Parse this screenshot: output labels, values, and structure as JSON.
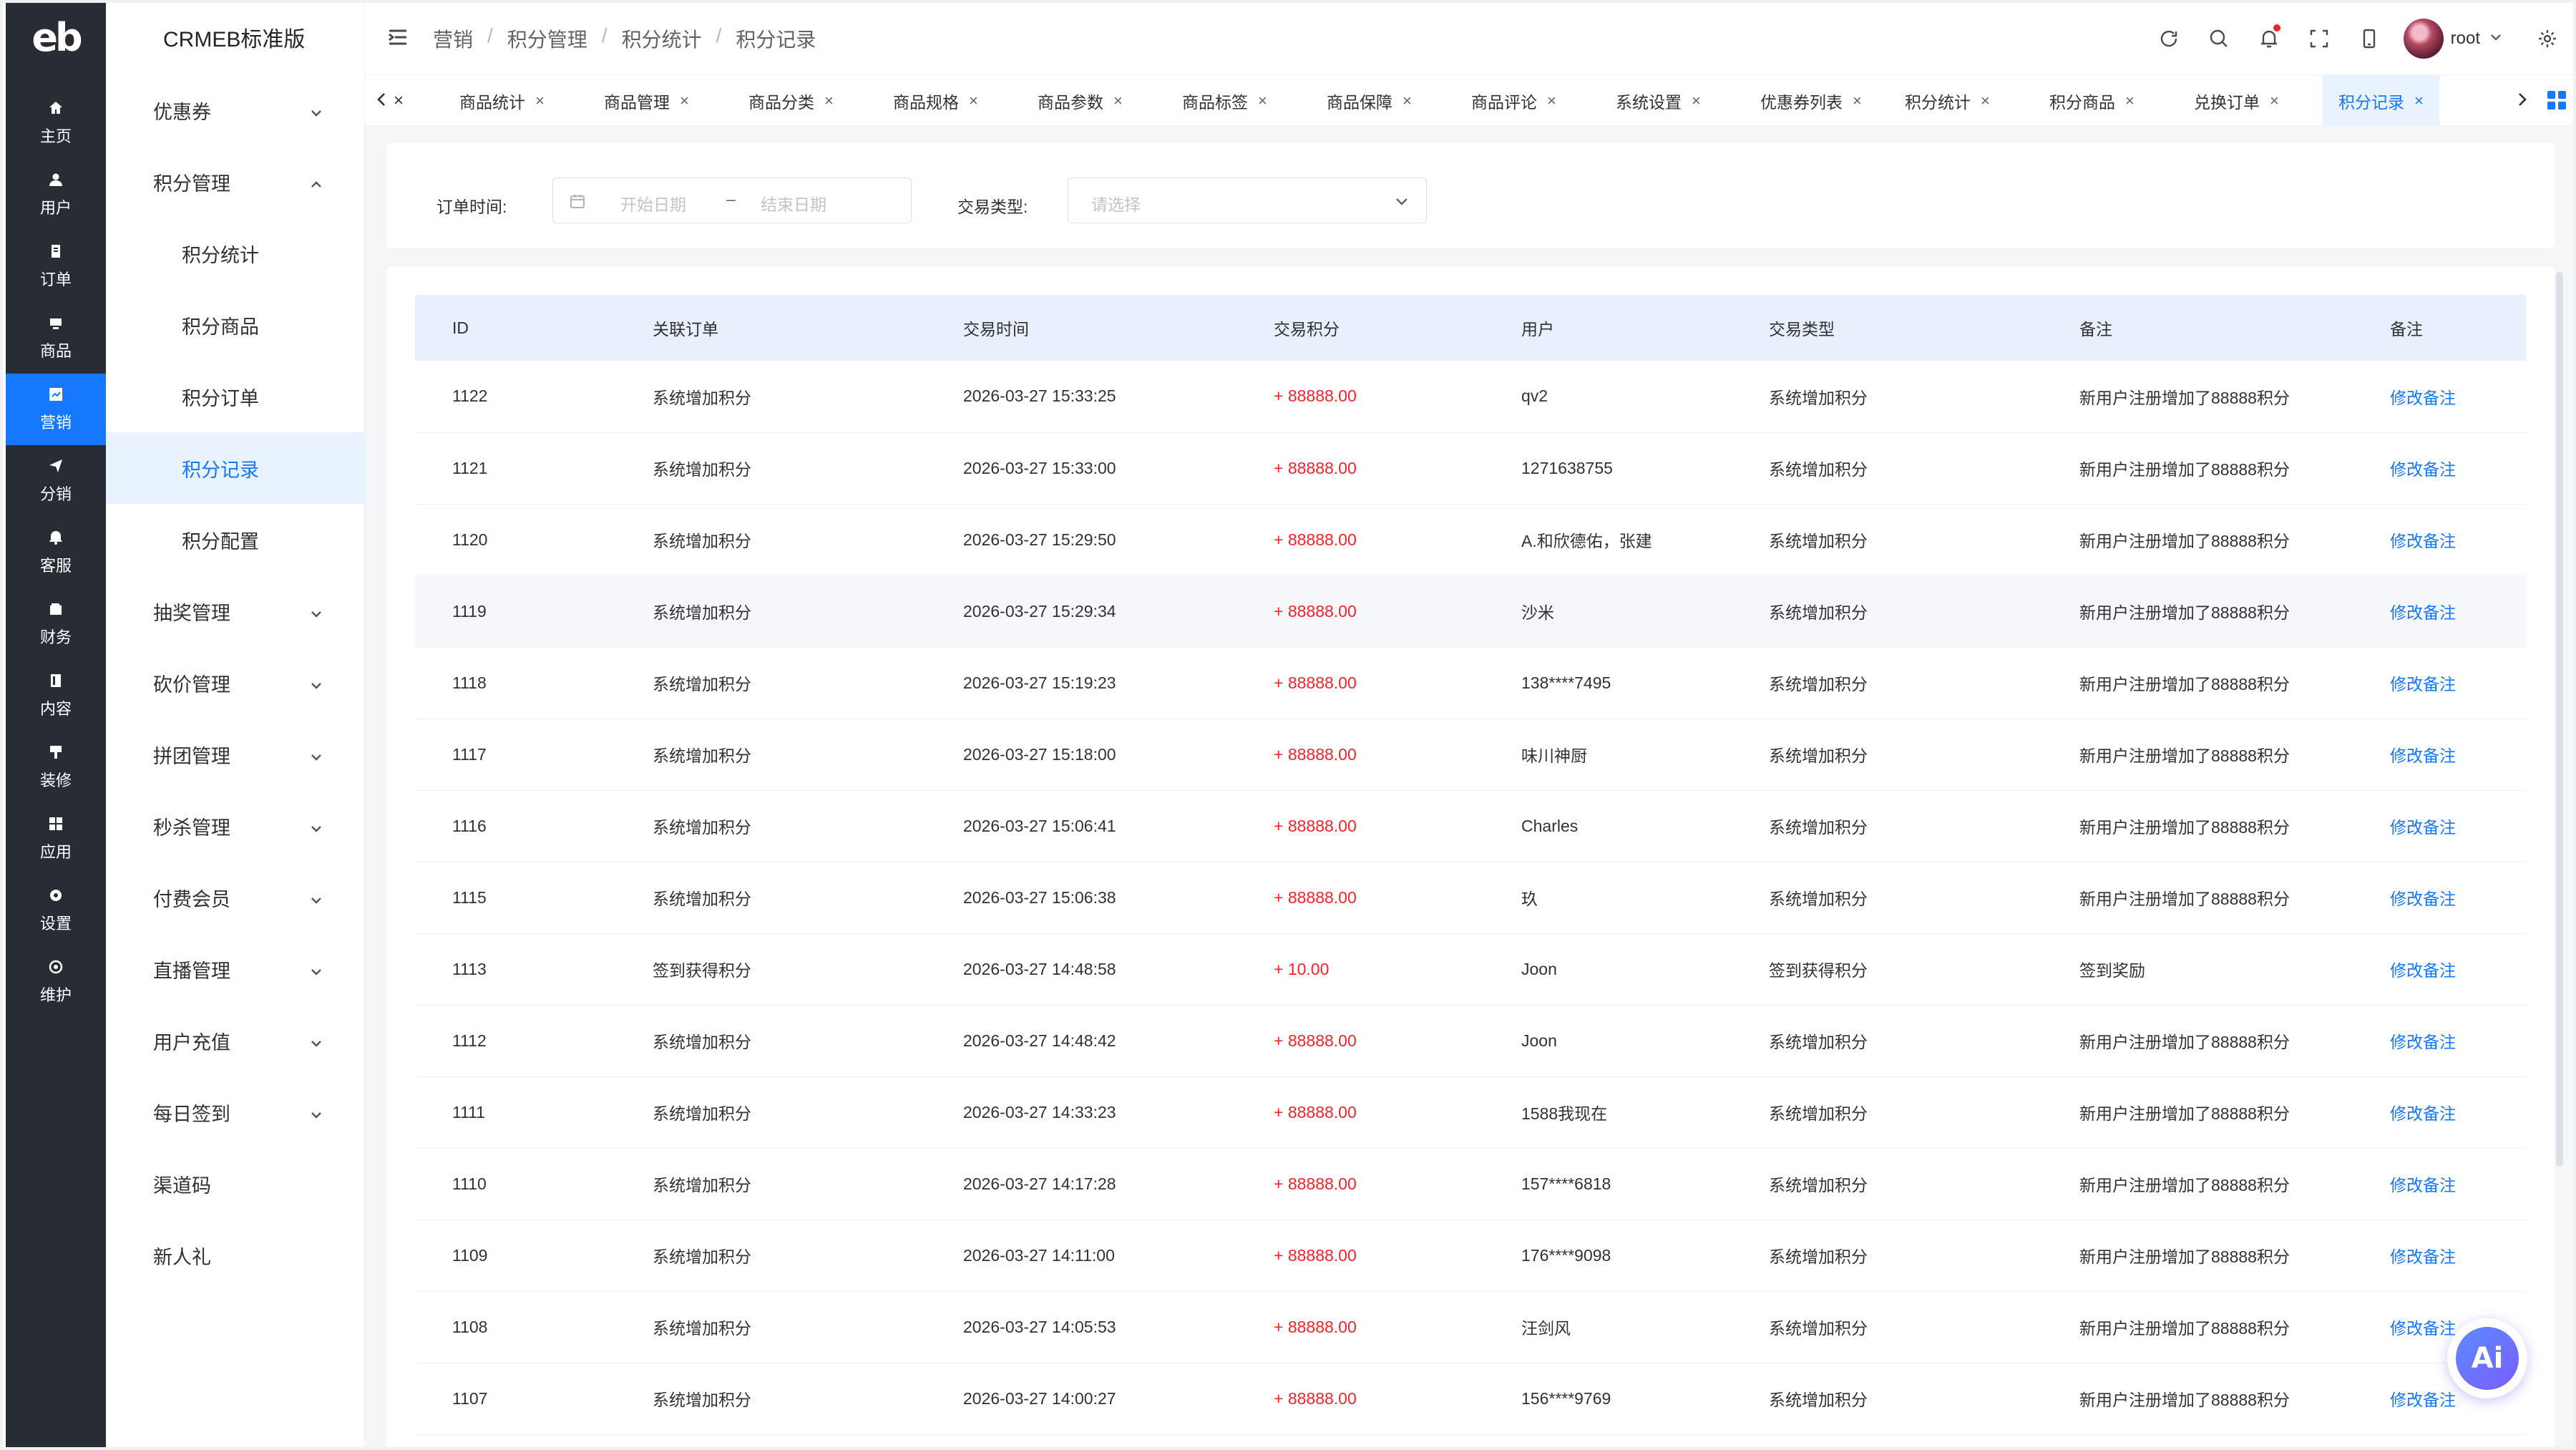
{
  "app": {
    "brand": "CRMEB标准版",
    "logo_text": "eb"
  },
  "rail": [
    {
      "label": "主页",
      "icon": "home-icon",
      "active": false
    },
    {
      "label": "用户",
      "icon": "user-icon",
      "active": false
    },
    {
      "label": "订单",
      "icon": "order-icon",
      "active": false
    },
    {
      "label": "商品",
      "icon": "product-icon",
      "active": false
    },
    {
      "label": "营销",
      "icon": "marketing-icon",
      "active": true
    },
    {
      "label": "分销",
      "icon": "distribution-icon",
      "active": false
    },
    {
      "label": "客服",
      "icon": "service-icon",
      "active": false
    },
    {
      "label": "财务",
      "icon": "finance-icon",
      "active": false
    },
    {
      "label": "内容",
      "icon": "content-icon",
      "active": false
    },
    {
      "label": "装修",
      "icon": "decoration-icon",
      "active": false
    },
    {
      "label": "应用",
      "icon": "apps-icon",
      "active": false
    },
    {
      "label": "设置",
      "icon": "settings-icon",
      "active": false
    },
    {
      "label": "维护",
      "icon": "maintenance-icon",
      "active": false
    }
  ],
  "menu": [
    {
      "label": "优惠券",
      "level": 1,
      "chevron": "down",
      "active": false
    },
    {
      "label": "积分管理",
      "level": 1,
      "chevron": "up",
      "active": false
    },
    {
      "label": "积分统计",
      "level": 2,
      "chevron": "",
      "active": false
    },
    {
      "label": "积分商品",
      "level": 2,
      "chevron": "",
      "active": false
    },
    {
      "label": "积分订单",
      "level": 2,
      "chevron": "",
      "active": false
    },
    {
      "label": "积分记录",
      "level": 2,
      "chevron": "",
      "active": true
    },
    {
      "label": "积分配置",
      "level": 2,
      "chevron": "",
      "active": false
    },
    {
      "label": "抽奖管理",
      "level": 1,
      "chevron": "down",
      "active": false
    },
    {
      "label": "砍价管理",
      "level": 1,
      "chevron": "down",
      "active": false
    },
    {
      "label": "拼团管理",
      "level": 1,
      "chevron": "down",
      "active": false
    },
    {
      "label": "秒杀管理",
      "level": 1,
      "chevron": "down",
      "active": false
    },
    {
      "label": "付费会员",
      "level": 1,
      "chevron": "down",
      "active": false
    },
    {
      "label": "直播管理",
      "level": 1,
      "chevron": "down",
      "active": false
    },
    {
      "label": "用户充值",
      "level": 1,
      "chevron": "down",
      "active": false
    },
    {
      "label": "每日签到",
      "level": 1,
      "chevron": "down",
      "active": false
    },
    {
      "label": "渠道码",
      "level": 1,
      "chevron": "",
      "active": false
    },
    {
      "label": "新人礼",
      "level": 1,
      "chevron": "",
      "active": false
    }
  ],
  "breadcrumb": [
    "营销",
    "积分管理",
    "积分统计",
    "积分记录"
  ],
  "header": {
    "username": "root"
  },
  "tabs": [
    {
      "label": "商品统计",
      "active": false
    },
    {
      "label": "商品管理",
      "active": false
    },
    {
      "label": "商品分类",
      "active": false
    },
    {
      "label": "商品规格",
      "active": false
    },
    {
      "label": "商品参数",
      "active": false
    },
    {
      "label": "商品标签",
      "active": false
    },
    {
      "label": "商品保障",
      "active": false
    },
    {
      "label": "商品评论",
      "active": false
    },
    {
      "label": "系统设置",
      "active": false
    },
    {
      "label": "优惠券列表",
      "active": false
    },
    {
      "label": "积分统计",
      "active": false
    },
    {
      "label": "积分商品",
      "active": false
    },
    {
      "label": "兑换订单",
      "active": false
    },
    {
      "label": "积分记录",
      "active": true
    }
  ],
  "filters": {
    "order_time_label": "订单时间:",
    "start_placeholder": "开始日期",
    "range_sep": "–",
    "end_placeholder": "结束日期",
    "trade_type_label": "交易类型:",
    "trade_type_placeholder": "请选择"
  },
  "table": {
    "columns": [
      "ID",
      "关联订单",
      "交易时间",
      "交易积分",
      "用户",
      "交易类型",
      "备注",
      "备注"
    ],
    "rows": [
      [
        "1122",
        "系统增加积分",
        "2026-03-27 15:33:25",
        "+ 88888.00",
        "qv2",
        "系统增加积分",
        "新用户注册增加了88888积分",
        "修改备注"
      ],
      [
        "1121",
        "系统增加积分",
        "2026-03-27 15:33:00",
        "+ 88888.00",
        "1271638755",
        "系统增加积分",
        "新用户注册增加了88888积分",
        "修改备注"
      ],
      [
        "1120",
        "系统增加积分",
        "2026-03-27 15:29:50",
        "+ 88888.00",
        "A.和欣德佑，张建",
        "系统增加积分",
        "新用户注册增加了88888积分",
        "修改备注"
      ],
      [
        "1119",
        "系统增加积分",
        "2026-03-27 15:29:34",
        "+ 88888.00",
        "沙米",
        "系统增加积分",
        "新用户注册增加了88888积分",
        "修改备注"
      ],
      [
        "1118",
        "系统增加积分",
        "2026-03-27 15:19:23",
        "+ 88888.00",
        "138****7495",
        "系统增加积分",
        "新用户注册增加了88888积分",
        "修改备注"
      ],
      [
        "1117",
        "系统增加积分",
        "2026-03-27 15:18:00",
        "+ 88888.00",
        "味川神厨",
        "系统增加积分",
        "新用户注册增加了88888积分",
        "修改备注"
      ],
      [
        "1116",
        "系统增加积分",
        "2026-03-27 15:06:41",
        "+ 88888.00",
        "Charles",
        "系统增加积分",
        "新用户注册增加了88888积分",
        "修改备注"
      ],
      [
        "1115",
        "系统增加积分",
        "2026-03-27 15:06:38",
        "+ 88888.00",
        "玖",
        "系统增加积分",
        "新用户注册增加了88888积分",
        "修改备注"
      ],
      [
        "1113",
        "签到获得积分",
        "2026-03-27 14:48:58",
        "+ 10.00",
        "Joon",
        "签到获得积分",
        "签到奖励",
        "修改备注"
      ],
      [
        "1112",
        "系统增加积分",
        "2026-03-27 14:48:42",
        "+ 88888.00",
        "Joon",
        "系统增加积分",
        "新用户注册增加了88888积分",
        "修改备注"
      ],
      [
        "1111",
        "系统增加积分",
        "2026-03-27 14:33:23",
        "+ 88888.00",
        "1588我现在",
        "系统增加积分",
        "新用户注册增加了88888积分",
        "修改备注"
      ],
      [
        "1110",
        "系统增加积分",
        "2026-03-27 14:17:28",
        "+ 88888.00",
        "157****6818",
        "系统增加积分",
        "新用户注册增加了88888积分",
        "修改备注"
      ],
      [
        "1109",
        "系统增加积分",
        "2026-03-27 14:11:00",
        "+ 88888.00",
        "176****9098",
        "系统增加积分",
        "新用户注册增加了88888积分",
        "修改备注"
      ],
      [
        "1108",
        "系统增加积分",
        "2026-03-27 14:05:53",
        "+ 88888.00",
        "汪剑风",
        "系统增加积分",
        "新用户注册增加了88888积分",
        "修改备注"
      ],
      [
        "1107",
        "系统增加积分",
        "2026-03-27 14:00:27",
        "+ 88888.00",
        "156****9769",
        "系统增加积分",
        "新用户注册增加了88888积分",
        "修改备注"
      ]
    ]
  },
  "ai_button": {
    "label": "Ai"
  },
  "colors": {
    "accent": "#1677ff",
    "rail_bg": "#282c34",
    "amount": "#f5222d",
    "header_row_bg": "#e8f0fd"
  }
}
